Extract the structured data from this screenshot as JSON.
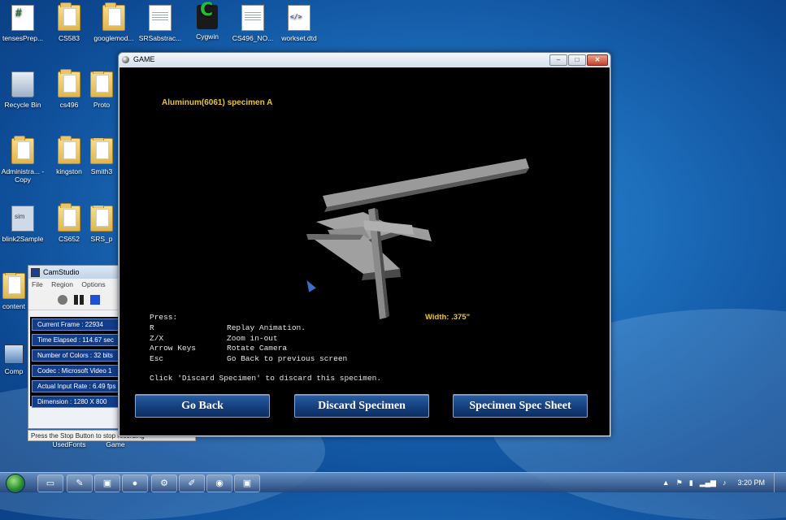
{
  "desktop": {
    "icons": [
      {
        "label": "tensesPrep...",
        "kind": "excel"
      },
      {
        "label": "CS583",
        "kind": "folder"
      },
      {
        "label": "googlemod...",
        "kind": "folder"
      },
      {
        "label": "SRSabstrac...",
        "kind": "doc"
      },
      {
        "label": "Cygwin",
        "kind": "cygwin"
      },
      {
        "label": "CS496_NO...",
        "kind": "doc"
      },
      {
        "label": "workset.dtd",
        "kind": "dtd"
      },
      {
        "label": "Recycle Bin",
        "kind": "bin"
      },
      {
        "label": "cs496",
        "kind": "folder"
      },
      {
        "label": "Proto",
        "kind": "folder"
      },
      {
        "label": "Administra... - Copy",
        "kind": "folder"
      },
      {
        "label": "kingston",
        "kind": "folder"
      },
      {
        "label": "Smith3",
        "kind": "folder"
      },
      {
        "label": "blink2Sample",
        "kind": "sim"
      },
      {
        "label": "CS652",
        "kind": "folder"
      },
      {
        "label": "SRS_p",
        "kind": "folder"
      },
      {
        "label": "content",
        "kind": "folder"
      },
      {
        "label": "Comp",
        "kind": "computer"
      },
      {
        "label": "UsedFonts",
        "kind": "text"
      },
      {
        "label": "Game",
        "kind": "text"
      }
    ]
  },
  "game": {
    "window_title": "GAME",
    "specimen_title": "Aluminum(6061) specimen A",
    "width_label": "Width: .375\"",
    "help_heading": "Press:",
    "help_rows": [
      {
        "key": "R",
        "desc": "Replay Animation."
      },
      {
        "key": "Z/X",
        "desc": "Zoom in-out"
      },
      {
        "key": "Arrow Keys",
        "desc": "Rotate Camera"
      },
      {
        "key": "Esc",
        "desc": "Go Back to previous screen"
      }
    ],
    "discard_note": "Click 'Discard Specimen' to discard this specimen.",
    "buttons": {
      "go_back": "Go Back",
      "discard": "Discard Specimen",
      "spec_sheet": "Specimen Spec Sheet"
    }
  },
  "camstudio": {
    "title": "CamStudio",
    "menu": [
      "File",
      "Region",
      "Options"
    ],
    "stats": [
      "Current Frame : 22934",
      "Time Elapsed : 114.67 sec",
      "Number of Colors : 32 bits",
      "Codec : Microsoft Video 1",
      "Actual Input Rate : 6.49 fps",
      "Dimension : 1280 X 800"
    ],
    "status": "Press the Stop Button to stop recording"
  },
  "taskbar": {
    "clock": "3:20 PM"
  }
}
